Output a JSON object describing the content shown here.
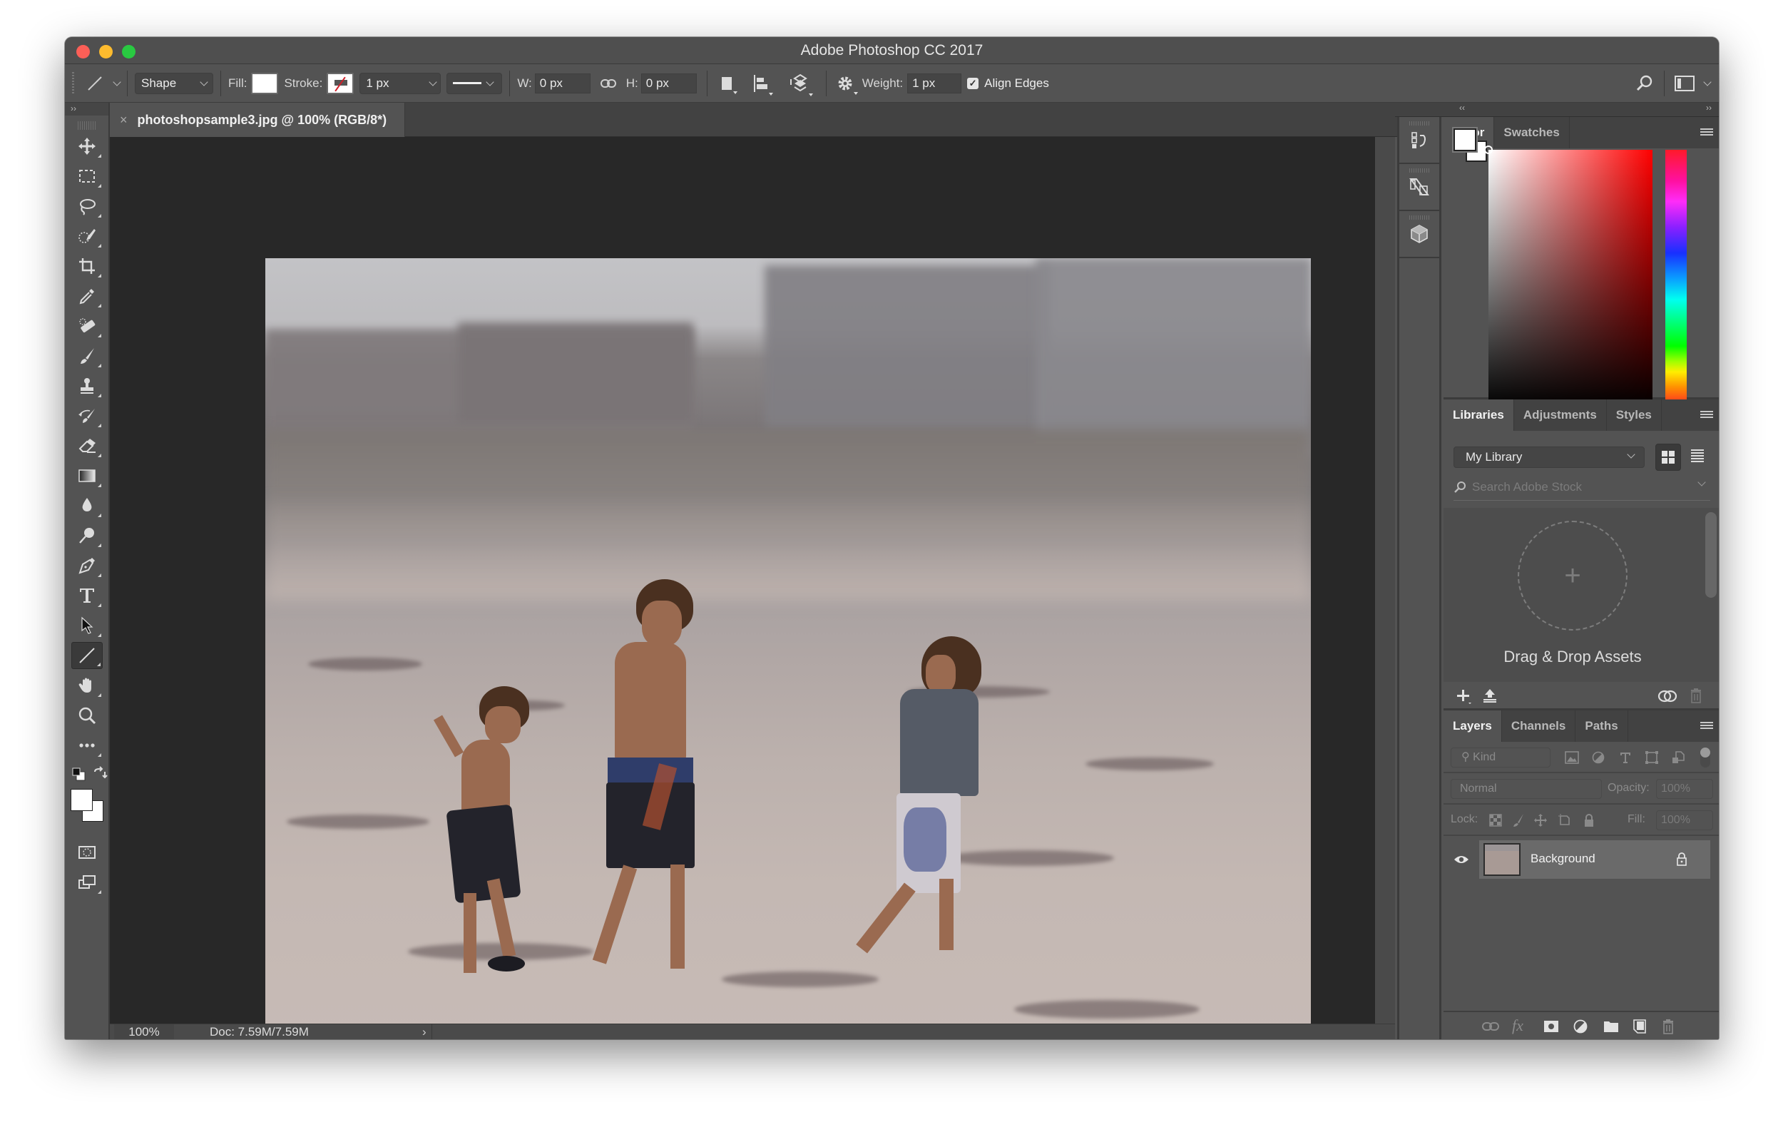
{
  "window": {
    "title": "Adobe Photoshop CC 2017"
  },
  "options_bar": {
    "tool_icon": "line-tool-icon",
    "mode": "Shape",
    "fill_label": "Fill:",
    "fill_color": "#ffffff",
    "stroke_label": "Stroke:",
    "stroke_width": "1 px",
    "w_label": "W:",
    "w_value": "0 px",
    "h_label": "H:",
    "h_value": "0 px",
    "weight_label": "Weight:",
    "weight_value": "1 px",
    "align_edges_label": "Align Edges",
    "align_edges_checked": true
  },
  "document": {
    "tab_name": "photoshopsample3.jpg @ 100% (RGB/8*)",
    "close_glyph": "×",
    "zoom": "100%",
    "doc_info": "Doc: 7.59M/7.59M",
    "status_arrow": "›"
  },
  "toolbar": {
    "collapse": "››",
    "tools": [
      {
        "name": "move-tool",
        "icon": "move-icon"
      },
      {
        "name": "marquee-tool",
        "icon": "marquee-icon"
      },
      {
        "name": "lasso-tool",
        "icon": "lasso-icon"
      },
      {
        "name": "quick-selection-tool",
        "icon": "quick-selection-icon"
      },
      {
        "name": "crop-tool",
        "icon": "crop-icon"
      },
      {
        "name": "eyedropper-tool",
        "icon": "eyedropper-icon"
      },
      {
        "name": "healing-brush-tool",
        "icon": "bandage-icon"
      },
      {
        "name": "brush-tool",
        "icon": "brush-icon"
      },
      {
        "name": "clone-stamp-tool",
        "icon": "stamp-icon"
      },
      {
        "name": "history-brush-tool",
        "icon": "history-brush-icon"
      },
      {
        "name": "eraser-tool",
        "icon": "eraser-icon"
      },
      {
        "name": "gradient-tool",
        "icon": "gradient-icon"
      },
      {
        "name": "blur-tool",
        "icon": "drop-icon"
      },
      {
        "name": "dodge-tool",
        "icon": "dodge-icon"
      },
      {
        "name": "pen-tool",
        "icon": "pen-icon"
      },
      {
        "name": "type-tool",
        "icon": "type-icon"
      },
      {
        "name": "path-selection-tool",
        "icon": "arrow-icon"
      },
      {
        "name": "line-tool",
        "icon": "line-icon",
        "active": true
      },
      {
        "name": "hand-tool",
        "icon": "hand-icon"
      },
      {
        "name": "zoom-tool",
        "icon": "magnifier-icon"
      },
      {
        "name": "edit-toolbar",
        "icon": "more-icon"
      }
    ],
    "foreground_color": "#ffffff",
    "background_color": "#ffffff"
  },
  "right_dock": {
    "collapse_left": "‹‹",
    "collapse_right": "››",
    "side_icons": [
      "history-icon",
      "clone-source-icon",
      "3d-cube-icon"
    ]
  },
  "color_panel": {
    "tabs": [
      "Color",
      "Swatches"
    ],
    "active_tab": "Color",
    "hue_color": "#ff0000",
    "foreground": "#ffffff",
    "background": "#ffffff"
  },
  "libraries_panel": {
    "tabs": [
      "Libraries",
      "Adjustments",
      "Styles"
    ],
    "active_tab": "Libraries",
    "library_select": "My Library",
    "search_placeholder": "Search Adobe Stock",
    "drop_plus": "+",
    "drop_text": "Drag & Drop Assets"
  },
  "layers_panel": {
    "tabs": [
      "Layers",
      "Channels",
      "Paths"
    ],
    "active_tab": "Layers",
    "filter_kind": "Kind",
    "blend_mode": "Normal",
    "opacity_label": "Opacity:",
    "opacity_value": "100%",
    "lock_label": "Lock:",
    "fill_label": "Fill:",
    "fill_value": "100%",
    "layers": [
      {
        "name": "Background",
        "visible": true,
        "locked": true
      }
    ]
  }
}
